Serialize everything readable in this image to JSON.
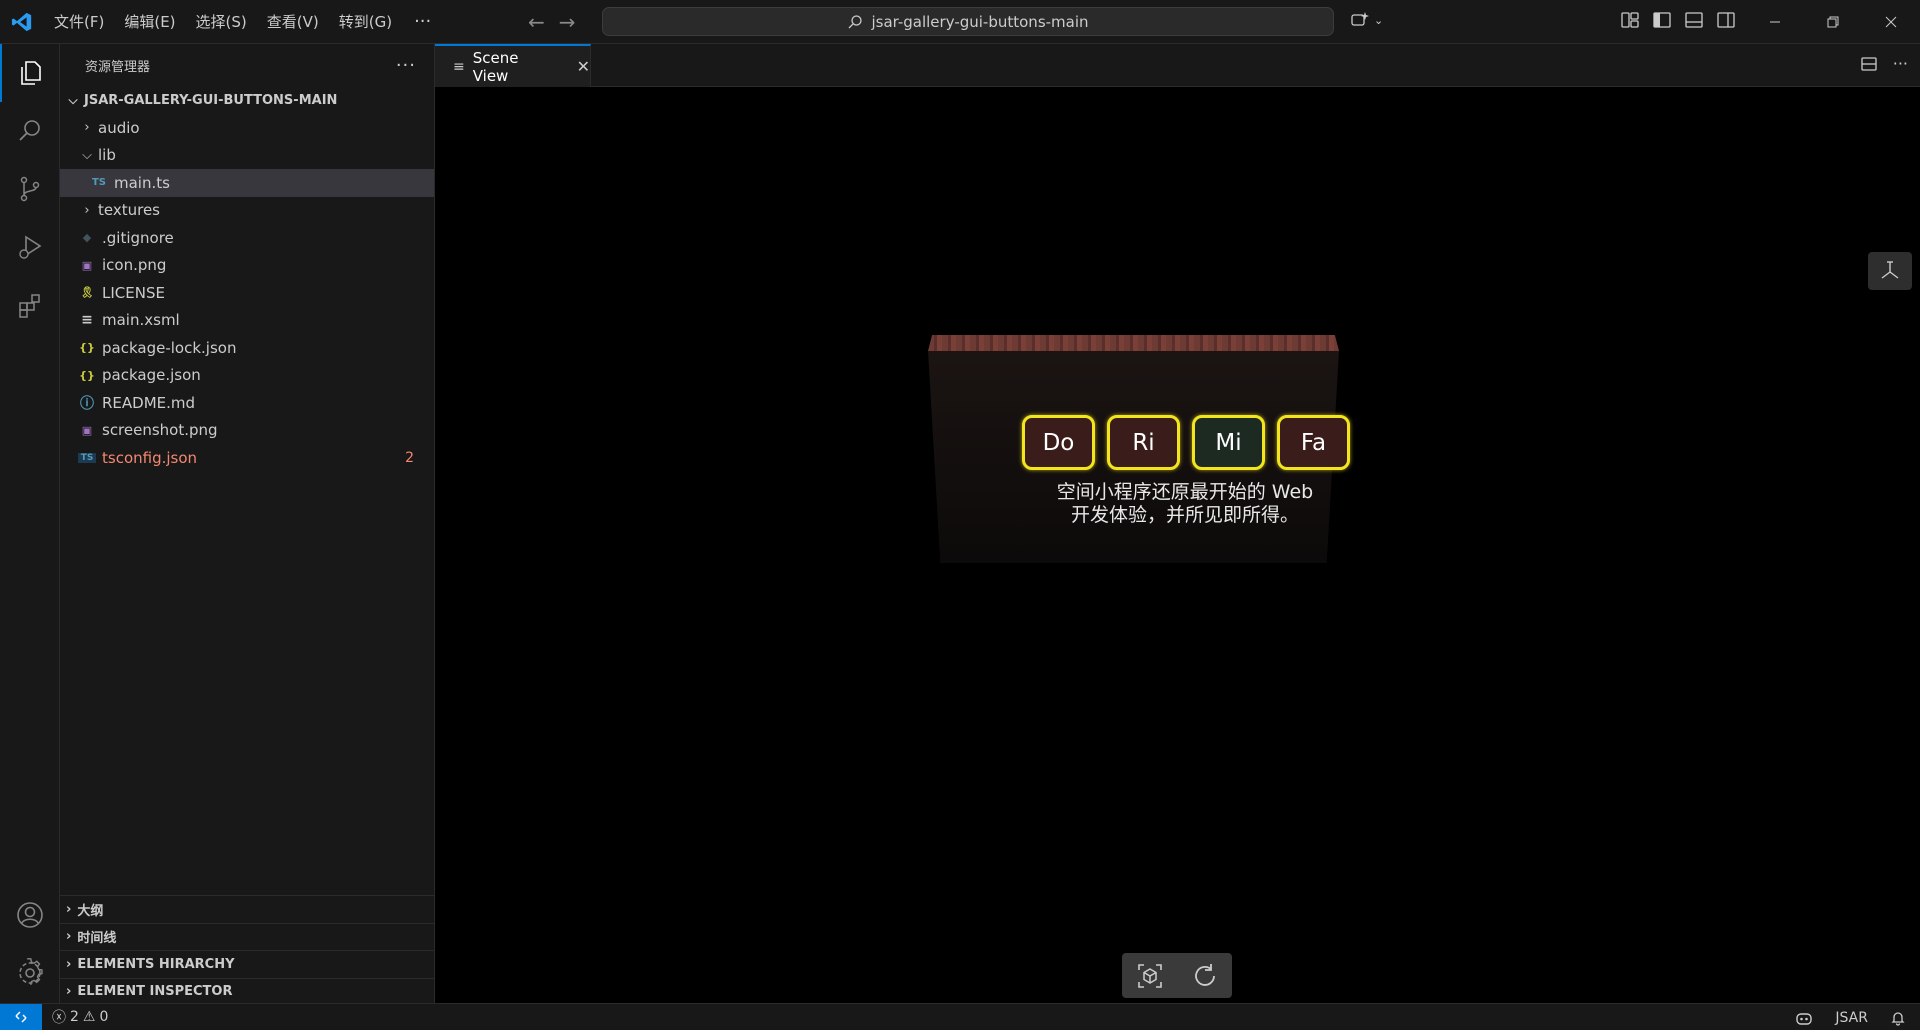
{
  "titlebar": {
    "menu": [
      "文件(F)",
      "编辑(E)",
      "选择(S)",
      "查看(V)",
      "转到(G)"
    ],
    "more": "···",
    "search_text": "jsar-gallery-gui-buttons-main"
  },
  "sidebar": {
    "title": "资源管理器",
    "more": "···",
    "root": "JSAR-GALLERY-GUI-BUTTONS-MAIN",
    "items": [
      {
        "label": "audio",
        "icon": "folder-closed"
      },
      {
        "label": "lib",
        "icon": "folder-open"
      },
      {
        "label": "main.ts",
        "icon": "ts-file",
        "icon_text": "TS",
        "selected": true
      },
      {
        "label": "textures",
        "icon": "folder-closed"
      },
      {
        "label": ".gitignore",
        "icon": "git-icon",
        "icon_text": "◆"
      },
      {
        "label": "icon.png",
        "icon": "image-icon",
        "icon_text": "▣"
      },
      {
        "label": "LICENSE",
        "icon": "license-icon",
        "icon_text": "🎗"
      },
      {
        "label": "main.xsml",
        "icon": "lines-icon",
        "icon_text": "≡"
      },
      {
        "label": "package-lock.json",
        "icon": "json-icon",
        "icon_text": "{}"
      },
      {
        "label": "package.json",
        "icon": "json-icon",
        "icon_text": "{}"
      },
      {
        "label": "README.md",
        "icon": "info-icon",
        "icon_text": "ⓘ"
      },
      {
        "label": "screenshot.png",
        "icon": "image-icon",
        "icon_text": "▣"
      },
      {
        "label": "tsconfig.json",
        "icon": "tsconfig-icon",
        "icon_text": "TS",
        "error_count": "2"
      }
    ],
    "sections": [
      "大纲",
      "时间线",
      "ELEMENTS HIRARCHY",
      "ELEMENT INSPECTOR"
    ]
  },
  "editor": {
    "tab_label": "Scene View",
    "scene": {
      "buttons": [
        "Do",
        "Ri",
        "Mi",
        "Fa"
      ],
      "button_fills": [
        "#3a1d1a",
        "#3a1d1a",
        "#1d2a22",
        "#3a1d1a"
      ],
      "caption_line1": "空间小程序还原最开始的 Web",
      "caption_line2": "开发体验，并所见即所得。"
    }
  },
  "statusbar": {
    "errors": "2",
    "warnings": "0",
    "language": "JSAR"
  },
  "colors": {
    "accent": "#0078d4",
    "button_border": "#f2e51e",
    "error": "#f48771"
  }
}
